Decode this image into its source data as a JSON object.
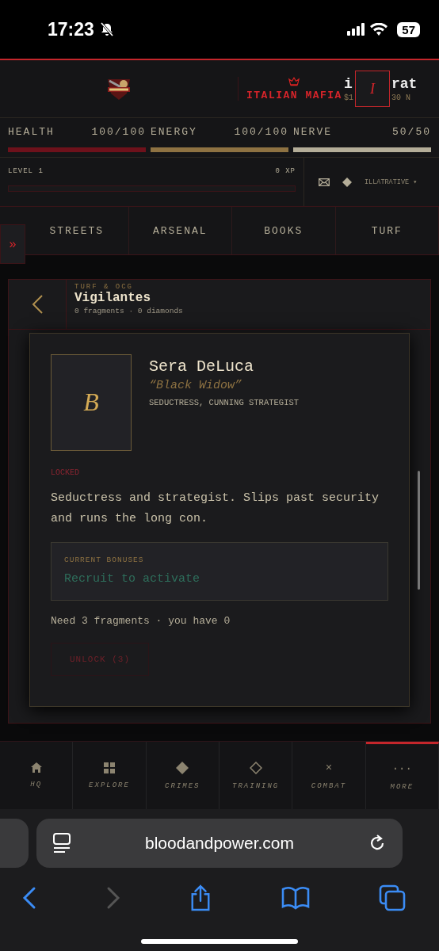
{
  "status_bar": {
    "time": "17:23",
    "battery": "57"
  },
  "header": {
    "faction": "ITALIAN MAFIA",
    "username_start": "i",
    "username_end": "rat",
    "money_start": "$1",
    "money_end": "30 N",
    "avatar": "I"
  },
  "stats": [
    {
      "label": "HEALTH",
      "reading": "100/100",
      "level": 1,
      "color": "#6e111b"
    },
    {
      "label": "ENERGY",
      "reading": "100/100",
      "level": 1,
      "color": "#8e7242"
    },
    {
      "label": "NERVE",
      "reading": "50/50",
      "level": 1,
      "color": "#b4ad98"
    }
  ],
  "level": {
    "label": "LEVEL 1",
    "reading": "0 XP",
    "level": 0,
    "account": "ILLATRATIVE ▾"
  },
  "sidebar_toggle": "»",
  "tabs": [
    {
      "label": "STREETS",
      "selected": false
    },
    {
      "label": "ARSENAL",
      "selected": false
    },
    {
      "label": "BOOKS",
      "selected": false
    },
    {
      "label": "TURF",
      "selected": false
    }
  ],
  "panel": {
    "section": "TURF & OCG",
    "title": "Vigilantes",
    "subtitle": "0 fragments · 0 diamonds",
    "character": {
      "initial": "B",
      "name": "Sera DeLuca",
      "alias": "“Black Widow”",
      "traits": "SEDUCTRESS, CUNNING STRATEGIST",
      "status": "LOCKED",
      "description": "Seductress and strategist. Slips past security and runs the long con.",
      "bonus_label": "CURRENT BONUSES",
      "bonus_value": "Recruit to activate",
      "requirement": "Need 3 fragments · you have 0",
      "button": {
        "label": "UNLOCK (3)",
        "disabled": true
      }
    }
  },
  "bottom_nav": [
    {
      "label": "HQ",
      "kind": "home",
      "selected": false
    },
    {
      "label": "EXPLORE",
      "kind": "grid",
      "selected": false
    },
    {
      "label": "CRIMES",
      "kind": "diamond",
      "selected": false
    },
    {
      "label": "TRAINING",
      "kind": "diamond-outline",
      "selected": false
    },
    {
      "label": "COMBAT",
      "kind": "glyph",
      "glyph": "×",
      "selected": false
    },
    {
      "label": "MORE",
      "kind": "glyph",
      "glyph": "···",
      "selected": true
    }
  ],
  "browser": {
    "url": "bloodandpower.com"
  }
}
